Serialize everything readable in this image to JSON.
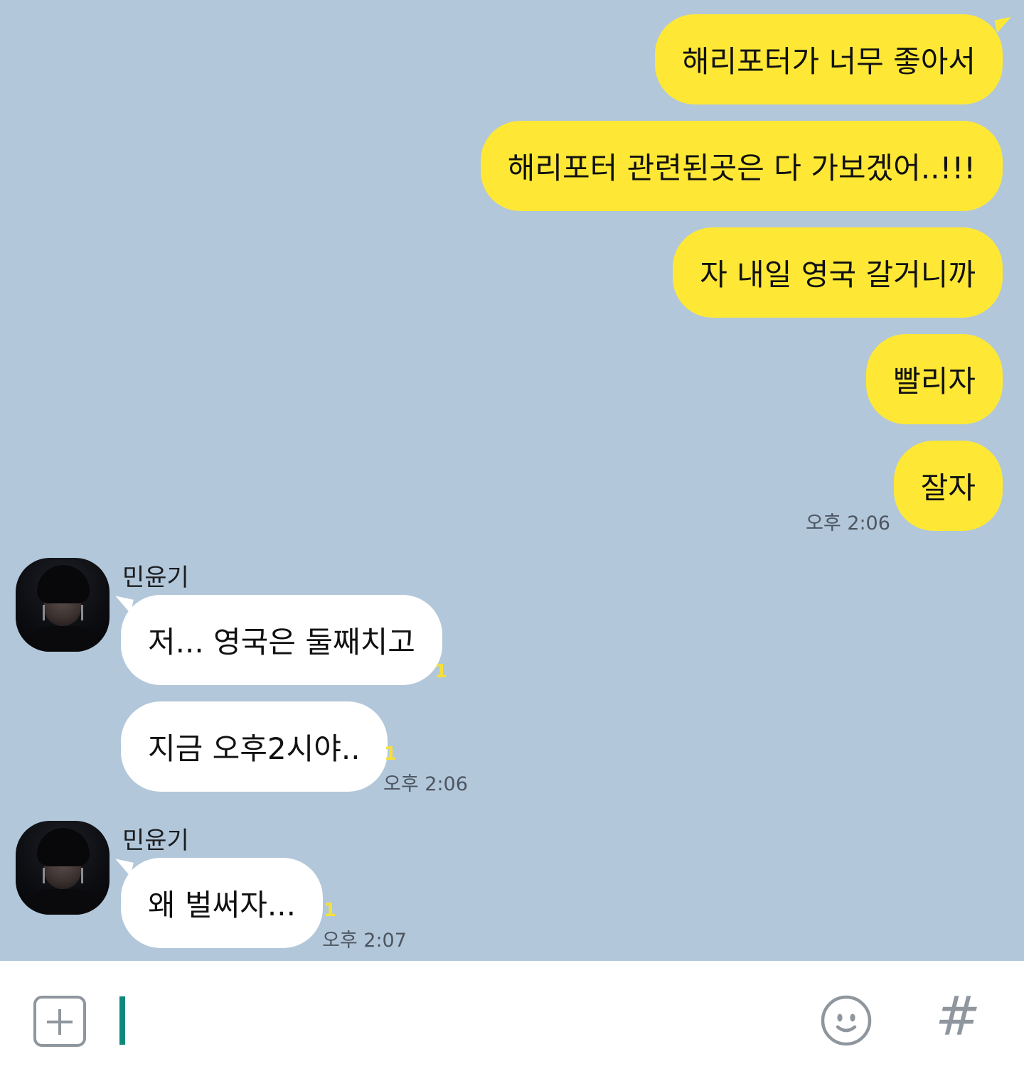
{
  "messages": {
    "outgoing": [
      {
        "text": "해리포터가 너무 좋아서"
      },
      {
        "text": "해리포터 관련된곳은 다 가보겠어..!!!"
      },
      {
        "text": "자 내일 영국 갈거니까"
      },
      {
        "text": "빨리자"
      },
      {
        "text": "잘자"
      }
    ],
    "outgoing_time": "오후 2:06",
    "incoming_groups": [
      {
        "sender": "민윤기",
        "messages": [
          {
            "text": "저... 영국은 둘째치고",
            "unread": "1"
          },
          {
            "text": "지금 오후2시야..",
            "unread": "1"
          }
        ],
        "time": "오후 2:06"
      },
      {
        "sender": "민윤기",
        "messages": [
          {
            "text": "왜 벌써자...",
            "unread": "1"
          }
        ],
        "time": "오후 2:07"
      }
    ]
  },
  "input": {
    "placeholder": "",
    "value": ""
  },
  "icons": {
    "attach": "plus-square-icon",
    "emoji": "smiley-icon",
    "hashtag": "hash-icon"
  },
  "colors": {
    "chat_background": "#b2c7da",
    "outgoing_bubble": "#fee835",
    "incoming_bubble": "#ffffff",
    "unread_count": "#f5e03a",
    "cursor": "#0f8a7a"
  }
}
